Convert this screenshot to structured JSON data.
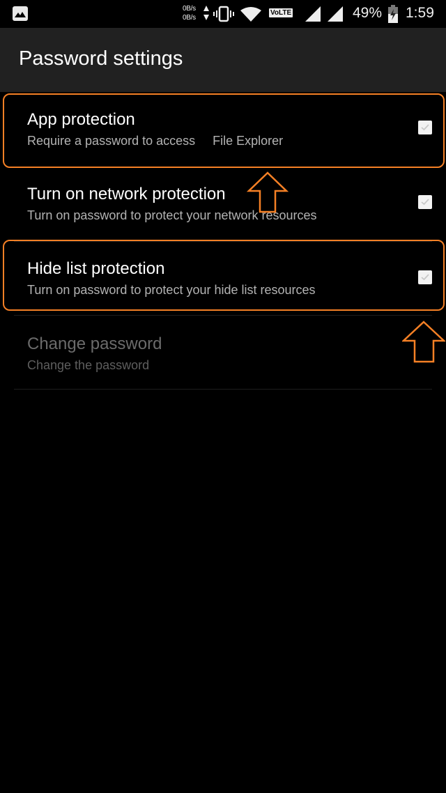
{
  "status_bar": {
    "notification_icon": "image-icon",
    "net_up": "0B/s",
    "net_down": "0B/s",
    "volte_label": "VoLTE",
    "battery_percent": "49%",
    "time": "1:59"
  },
  "toolbar": {
    "title": "Password settings"
  },
  "preferences": [
    {
      "title": "App protection",
      "summary": "Require a password to access     File Explorer",
      "checked": true,
      "enabled": true,
      "highlighted": true
    },
    {
      "title": "Turn on network protection",
      "summary": "Turn on password to protect your network resources",
      "checked": true,
      "enabled": true,
      "highlighted": false
    },
    {
      "title": "Hide list protection",
      "summary": "Turn on password to protect your hide list resources",
      "checked": true,
      "enabled": true,
      "highlighted": true
    },
    {
      "title": "Change password",
      "summary": "Change the password",
      "enabled": false
    }
  ],
  "annotations": {
    "highlight_color": "#f58025",
    "accent_background": "#212121"
  }
}
